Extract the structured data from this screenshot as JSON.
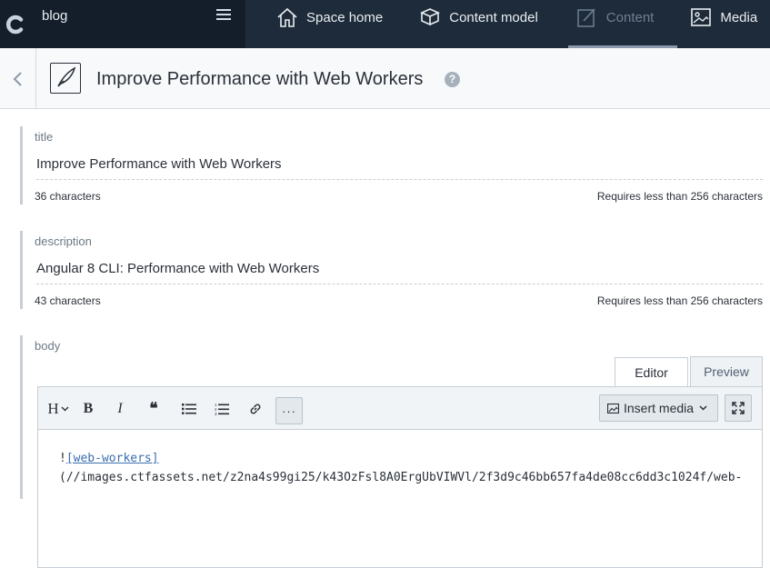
{
  "nav": {
    "space_name": "blog",
    "items": [
      {
        "label": "Space home",
        "icon": "house-icon"
      },
      {
        "label": "Content model",
        "icon": "cubes-icon"
      },
      {
        "label": "Content",
        "icon": "edit-document-icon",
        "active": true
      },
      {
        "label": "Media",
        "icon": "image-icon"
      }
    ]
  },
  "entry": {
    "title": "Improve Performance with Web Workers"
  },
  "fields": {
    "title": {
      "label": "title",
      "value": "Improve Performance with Web Workers",
      "count": "36 characters",
      "limit": "Requires less than 256 characters"
    },
    "description": {
      "label": "description",
      "value": "Angular 8 CLI: Performance with Web Workers",
      "count": "43 characters",
      "limit": "Requires less than 256 characters"
    },
    "body": {
      "label": "body",
      "tab_editor": "Editor",
      "tab_preview": "Preview",
      "insert_media": "Insert media",
      "line1_prefix": "!",
      "line1_link": "[web-workers]",
      "line2": "(//images.ctfassets.net/z2na4s99gi25/k43OzFsl8A0ErgUbVIWVl/2f3d9c46bb657fa4de08cc6dd3c1024f/web-"
    }
  },
  "toolbar": {
    "heading": "H",
    "bold": "B",
    "italic": "I",
    "quote": "❝",
    "more": "···"
  },
  "colors": {
    "nav_bg": "#1e2b3a",
    "space_bg": "#141e2a",
    "link": "#3a6fb0"
  }
}
